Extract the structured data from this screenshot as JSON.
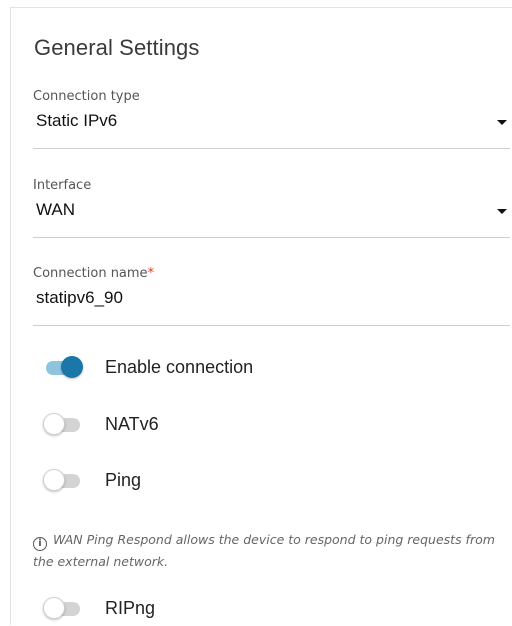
{
  "section": {
    "title": "General Settings"
  },
  "fields": {
    "connection_type": {
      "label": "Connection type",
      "value": "Static IPv6"
    },
    "interface": {
      "label": "Interface",
      "value": "WAN"
    },
    "connection_name": {
      "label": "Connection name",
      "required_mark": "*",
      "value": "statipv6_90"
    }
  },
  "toggles": {
    "enable_connection": {
      "label": "Enable connection",
      "state": "on"
    },
    "natv6": {
      "label": "NATv6",
      "state": "off"
    },
    "ping": {
      "label": "Ping",
      "state": "off"
    },
    "ripng": {
      "label": "RIPng",
      "state": "off"
    }
  },
  "hint": {
    "icon": "info-icon",
    "text": "WAN Ping Respond allows the device to respond to ping requests from the external network."
  },
  "colors": {
    "toggle_on_knob": "#1b77a8",
    "toggle_on_track": "#8fc4de",
    "toggle_off_track": "#d4d4d4",
    "required_mark": "#e2401b"
  }
}
